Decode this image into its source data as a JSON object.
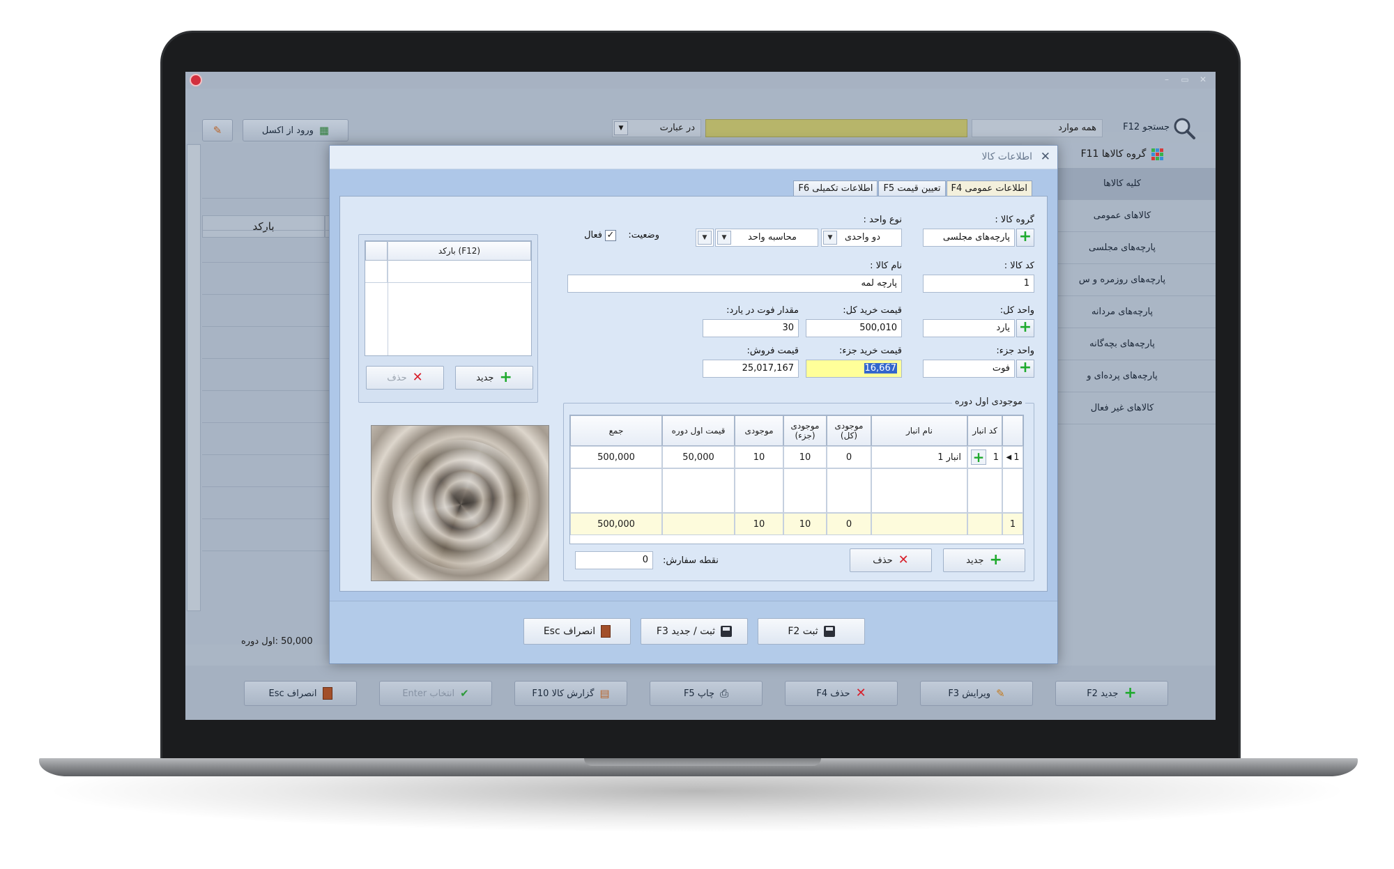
{
  "toolbar": {
    "search_label": "جستجو F12",
    "search_scope": "همه موارد",
    "search_mode": "در عبارت",
    "excel_import": "ورود از اکسل"
  },
  "grid": {
    "barcode_header": "بارکد",
    "footer_text": "50,000 :اول دوره"
  },
  "sidebar": {
    "group_header": "گروه کالاها F11",
    "categories": [
      "کلیه کالاها",
      "کالاهای عمومی",
      "پارچه‌های مجلسی",
      "پارچه‌های روزمره و س",
      "پارچه‌های مردانه",
      "پارچه‌های بچه‌گانه",
      "پارچه‌های پرده‌ای و",
      "کالاهای غیر فعال"
    ]
  },
  "bottom_buttons": {
    "new": "جدید F2",
    "edit": "ویرایش F3",
    "delete": "حذف F4",
    "print": "چاپ F5",
    "report": "گزارش کالا F10",
    "select": "انتخاب Enter",
    "cancel": "انصراف Esc"
  },
  "dialog": {
    "title": "اطلاعات کالا",
    "tabs": [
      "اطلاعات عمومی F4",
      "تعیین قیمت F5",
      "اطلاعات تکمیلی F6"
    ],
    "labels": {
      "group": "گروه کالا :",
      "unit_type": "نوع واحد :",
      "status": "وضعیت:",
      "active": "فعال",
      "code": "کد کالا :",
      "name": "نام کالا :",
      "main_unit": "واحد کل:",
      "buy_total": "قیمت خرید کل:",
      "feet_per_yard": "مقدار فوت در یارد:",
      "sub_unit": "واحد جزء:",
      "buy_part": "قیمت خرید جزء:",
      "sell_price": "قیمت فروش:",
      "stock_section": "موجودی اول دوره",
      "order_point": "نقطه سفارش:",
      "barcode_col": "(F12) بارکد"
    },
    "values": {
      "group": "پارچه‌های مجلسی",
      "unit_type": "دو واحدی",
      "calc_unit": "محاسبه واحد",
      "code": "1",
      "name": "پارچه لمه",
      "main_unit": "یارد",
      "buy_total": "500,010",
      "feet_per_yard": "30",
      "sub_unit": "فوت",
      "buy_part": "16,667",
      "sell_price": "25,017,167",
      "order_point": "0"
    },
    "stock_table": {
      "headers": [
        "کد انبار",
        "نام انبار",
        "موجودی (کل)",
        "موجودی (جزء)",
        "موجودی",
        "قیمت اول دوره",
        "جمع"
      ],
      "row": {
        "index": "1",
        "code": "1",
        "warehouse": "انبار 1",
        "total": "0",
        "part": "10",
        "stock": "10",
        "price": "50,000",
        "sum": "500,000"
      },
      "summary": {
        "index": "1",
        "total": "0",
        "part": "10",
        "stock": "10",
        "sum": "500,000"
      }
    },
    "buttons": {
      "new": "جدید",
      "delete": "حذف",
      "save": "ثبت F2",
      "save_new": "ثبت / جدید F3",
      "cancel": "انصراف Esc"
    }
  },
  "colors": {
    "accent_yellow": "#ffff99",
    "selection_blue": "#3366cc",
    "dialog_bg": "#dbe7f6"
  }
}
